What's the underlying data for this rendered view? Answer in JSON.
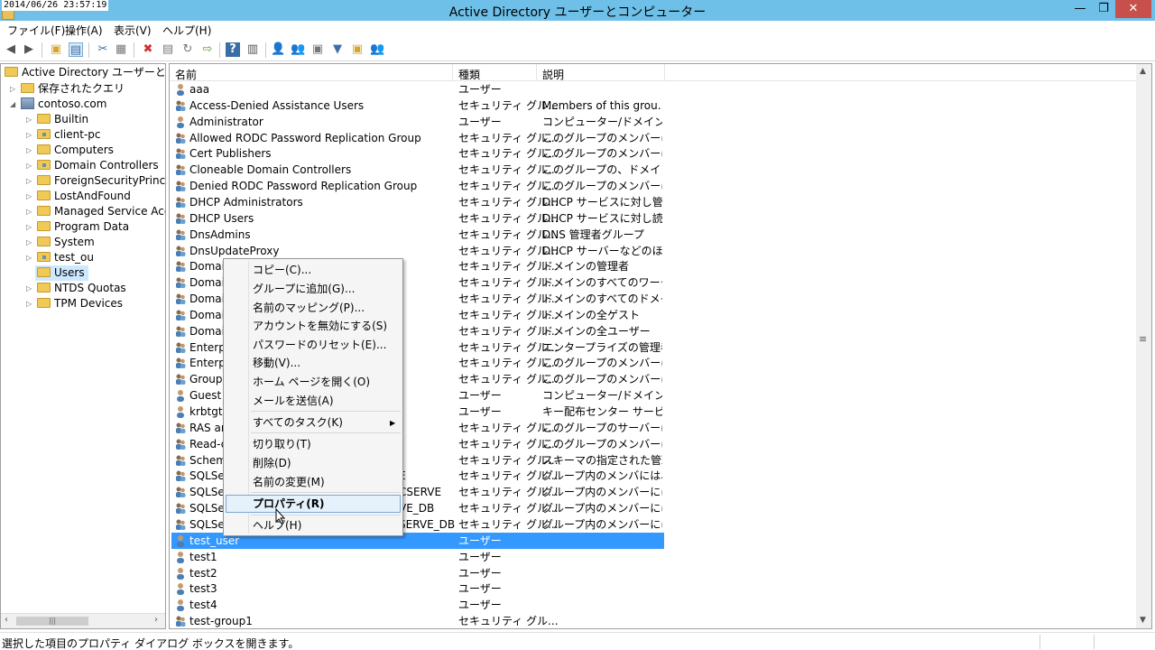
{
  "titlebar": {
    "timestamp": "2014/06/26 23:57:19",
    "title": "Active Directory ユーザーとコンピューター",
    "min": "—",
    "max": "❐",
    "close": "✕"
  },
  "menu": [
    "ファイル(F)",
    "操作(A)",
    "表示(V)",
    "ヘルプ(H)"
  ],
  "tree": {
    "root": "Active Directory ユーザーとコンピ",
    "saved_queries": "保存されたクエリ",
    "domain": "contoso.com",
    "items": [
      "Builtin",
      "client-pc",
      "Computers",
      "Domain Controllers",
      "ForeignSecurityPrincip",
      "LostAndFound",
      "Managed Service Acco",
      "Program Data",
      "System",
      "test_ou",
      "Users",
      "NTDS Quotas",
      "TPM Devices"
    ]
  },
  "list": {
    "headers": [
      "名前",
      "種類",
      "説明"
    ],
    "rows": [
      {
        "name": "aaa",
        "type": "ユーザー",
        "desc": ""
      },
      {
        "name": "Access-Denied Assistance Users",
        "type": "セキュリティ グル...",
        "desc": "Members of this grou..."
      },
      {
        "name": "Administrator",
        "type": "ユーザー",
        "desc": "コンピューター/ドメインの管..."
      },
      {
        "name": "Allowed RODC Password Replication Group",
        "type": "セキュリティ グル...",
        "desc": "このグループのメンバーは、..."
      },
      {
        "name": "Cert Publishers",
        "type": "セキュリティ グル...",
        "desc": "このグループのメンバーはデ..."
      },
      {
        "name": "Cloneable Domain Controllers",
        "type": "セキュリティ グル...",
        "desc": "このグループの、ドメイン コ..."
      },
      {
        "name": "Denied RODC Password Replication Group",
        "type": "セキュリティ グル...",
        "desc": "このグループのメンバーは、..."
      },
      {
        "name": "DHCP Administrators",
        "type": "セキュリティ グル...",
        "desc": "DHCP サービスに対し管..."
      },
      {
        "name": "DHCP Users",
        "type": "セキュリティ グル...",
        "desc": "DHCP サービスに対し読..."
      },
      {
        "name": "DnsAdmins",
        "type": "セキュリティ グル...",
        "desc": "DNS 管理者グループ"
      },
      {
        "name": "DnsUpdateProxy",
        "type": "セキュリティ グル...",
        "desc": "DHCP サーバーなどのほか..."
      },
      {
        "name": "Domain",
        "type": "セキュリティ グル...",
        "desc": "ドメインの管理者"
      },
      {
        "name": "Domain",
        "type": "セキュリティ グル...",
        "desc": "ドメインのすべてのワークス..."
      },
      {
        "name": "Domain",
        "type": "セキュリティ グル...",
        "desc": "ドメインのすべてのドメイン ..."
      },
      {
        "name": "Domain",
        "type": "セキュリティ グル...",
        "desc": "ドメインの全ゲスト"
      },
      {
        "name": "Domain",
        "type": "セキュリティ グル...",
        "desc": "ドメインの全ユーザー"
      },
      {
        "name": "Enterpr",
        "type": "セキュリティ グル...",
        "desc": "エンタープライズの管理者"
      },
      {
        "name": "Enterpr",
        "type": "セキュリティ グル...",
        "desc": "このグループのメンバーは、..."
      },
      {
        "name": "Group",
        "type": "セキュリティ グル...",
        "desc": "このグループのメンバーはド..."
      },
      {
        "name": "Guest",
        "type": "ユーザー",
        "desc": "コンピューター/ドメインへの..."
      },
      {
        "name": "krbtgt",
        "type": "ユーザー",
        "desc": "キー配布センター サービス ..."
      },
      {
        "name": "RAS an",
        "type": "セキュリティ グル...",
        "desc": "このグループのサーバーはユ..."
      },
      {
        "name": "Read-o",
        "type": "セキュリティ グル...",
        "desc": "このグループのメンバーは、..."
      },
      {
        "name": "Schem",
        "type": "セキュリティ グル...",
        "desc": "スキーマの指定された管理者"
      },
      {
        "name": "SQLSer",
        "type": "セキュリティ グル...",
        "desc": "グループ内のメンバには、S..."
      },
      {
        "name": "SQLSer",
        "type": "セキュリティ グル...",
        "desc": "グループ内のメンバーには、..."
      },
      {
        "name": "SQLSer",
        "type": "セキュリティ グル...",
        "desc": "グループ内のメンバーには、..."
      },
      {
        "name": "SQLSer",
        "type": "セキュリティ グル...",
        "desc": "グループ内のメンバーには、..."
      },
      {
        "name": "test_user",
        "type": "ユーザー",
        "desc": ""
      },
      {
        "name": "test1",
        "type": "ユーザー",
        "desc": ""
      },
      {
        "name": "test2",
        "type": "ユーザー",
        "desc": ""
      },
      {
        "name": "test3",
        "type": "ユーザー",
        "desc": ""
      },
      {
        "name": "test4",
        "type": "ユーザー",
        "desc": ""
      },
      {
        "name": "test-group1",
        "type": "セキュリティ グル...",
        "desc": ""
      }
    ],
    "overflow_fragments": [
      "E",
      "CSERVE",
      "VE_DB",
      "SERVE_DB"
    ]
  },
  "context_menu": {
    "items": [
      "コピー(C)...",
      "グループに追加(G)...",
      "名前のマッピング(P)...",
      "アカウントを無効にする(S)",
      "パスワードのリセット(E)...",
      "移動(V)...",
      "ホーム ページを開く(O)",
      "メールを送信(A)",
      "すべてのタスク(K)",
      "切り取り(T)",
      "削除(D)",
      "名前の変更(M)",
      "プロパティ(R)",
      "ヘルプ(H)"
    ]
  },
  "status": {
    "text": "選択した項目のプロパティ ダイアログ ボックスを開きます。"
  },
  "colors": {
    "titlebar": "#6fc0e8",
    "selection": "#3399ff",
    "close": "#c7504c"
  }
}
